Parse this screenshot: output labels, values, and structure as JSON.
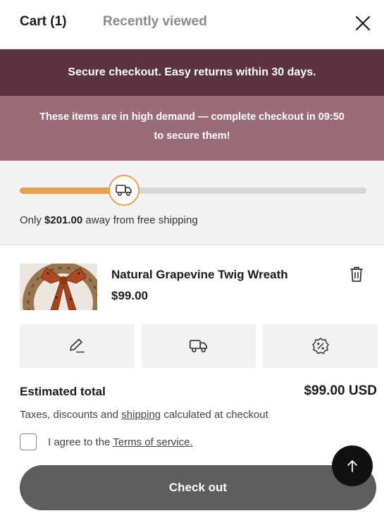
{
  "header": {
    "tabs": [
      {
        "label": "Cart (1)",
        "active": true
      },
      {
        "label": "Recently viewed",
        "active": false
      }
    ],
    "close_icon": "close-icon"
  },
  "banners": {
    "secure": "Secure checkout. Easy returns within 30 days.",
    "demand_line1": "These items are in high demand — complete checkout in ",
    "demand_timer": "09:50",
    "demand_line2": "to secure them!"
  },
  "shipping": {
    "progress_fraction": 0.3,
    "prefix": "Only ",
    "amount": "$201.00",
    "suffix": " away from free shipping",
    "icon": "truck-icon"
  },
  "cart_item": {
    "name": "Natural Grapevine Twig Wreath",
    "price": "$99.00",
    "delete_icon": "trash-icon"
  },
  "actions": [
    {
      "icon": "pencil-icon"
    },
    {
      "icon": "truck-icon"
    },
    {
      "icon": "discount-icon"
    }
  ],
  "summary": {
    "label": "Estimated total",
    "value": "$99.00 USD",
    "taxes_prefix": "Taxes, discounts and ",
    "taxes_link": "shipping",
    "taxes_suffix": " calculated at checkout"
  },
  "terms": {
    "prefix": "I agree to the ",
    "link": "Terms of service.",
    "checked": false
  },
  "checkout_label": "Check out",
  "colors": {
    "banner_dark": "#5b3340",
    "banner_light": "#9a6b78",
    "progress": "#e8a04e",
    "button": "#5e5e5e"
  }
}
